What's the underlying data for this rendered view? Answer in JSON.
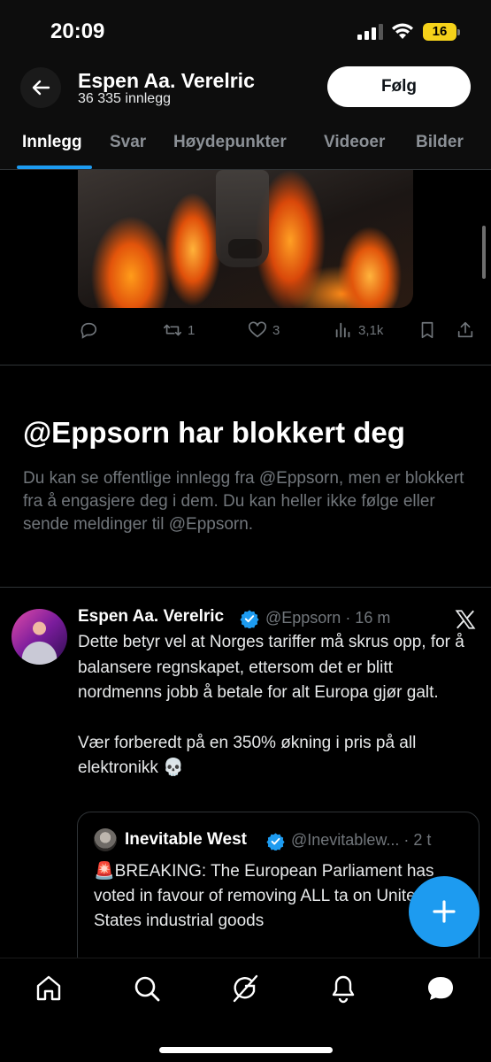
{
  "status_bar": {
    "time": "20:09",
    "battery": "16"
  },
  "header": {
    "name": "Espen Aa. Verelric",
    "post_count": "36 335 innlegg",
    "follow_label": "Følg"
  },
  "tabs": [
    {
      "label": "Innlegg"
    },
    {
      "label": "Svar"
    },
    {
      "label": "Høydepunkter"
    },
    {
      "label": "Videoer"
    },
    {
      "label": "Bilder"
    }
  ],
  "previous_post": {
    "reply_count": "",
    "retweets": "1",
    "likes": "3",
    "views": "3,1k"
  },
  "blocked": {
    "title": "@Eppsorn har blokkert deg",
    "text": "Du kan se offentlige innlegg fra @Eppsorn, men er blokkert fra å engasjere deg i dem. Du kan heller ikke følge eller sende meldinger til @Eppsorn."
  },
  "tweet": {
    "author": "Espen Aa. Verelric",
    "meta": "@Eppsorn · 16 m",
    "paragraph1": "Dette betyr vel at Norges tariffer må skrus opp, for å balansere regnskapet, ettersom det er blitt nordmenns jobb å betale for alt Europa gjør galt.",
    "paragraph2": "Vær forberedt på en 350% økning i pris på all elektronikk 💀"
  },
  "quote": {
    "author": "Inevitable West",
    "meta": "@Inevitablew... · 2 t",
    "text": "🚨BREAKING: The European Parliament has voted in favour of removing ALL ta on United States industrial goods"
  },
  "colors": {
    "accent": "#1d9bf0",
    "background": "#000000",
    "muted": "#71767b"
  },
  "nav": [
    "home-icon",
    "search-icon",
    "grok-icon",
    "notifications-icon",
    "messages-icon"
  ]
}
